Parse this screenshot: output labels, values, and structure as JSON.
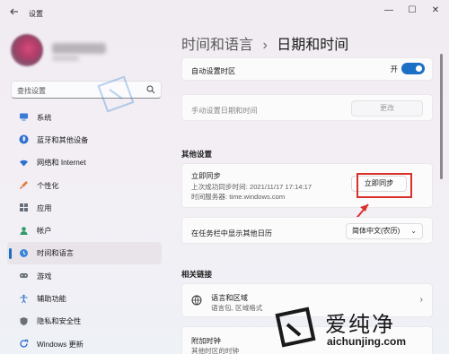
{
  "window": {
    "app_title": "设置",
    "controls": [
      "—",
      "☐",
      "✕"
    ]
  },
  "sidebar": {
    "search_placeholder": "查找设置",
    "items": [
      {
        "label": "系统",
        "icon": "monitor-icon"
      },
      {
        "label": "蓝牙和其他设备",
        "icon": "bluetooth-icon"
      },
      {
        "label": "网络和 Internet",
        "icon": "wifi-icon"
      },
      {
        "label": "个性化",
        "icon": "brush-icon"
      },
      {
        "label": "应用",
        "icon": "apps-icon"
      },
      {
        "label": "帐户",
        "icon": "person-icon"
      },
      {
        "label": "时间和语言",
        "icon": "globe-clock-icon",
        "active": true
      },
      {
        "label": "游戏",
        "icon": "gamepad-icon"
      },
      {
        "label": "辅助功能",
        "icon": "accessibility-icon"
      },
      {
        "label": "隐私和安全性",
        "icon": "shield-icon"
      },
      {
        "label": "Windows 更新",
        "icon": "update-icon"
      }
    ]
  },
  "header": {
    "crumb": "时间和语言",
    "separator": "›",
    "title": "日期和时间"
  },
  "auto_timezone": {
    "label": "自动设置时区",
    "state_text": "开"
  },
  "manual_time": {
    "label": "手动设置日期和时间",
    "button": "更改"
  },
  "other_settings": {
    "title": "其他设置",
    "sync": {
      "label": "立即同步",
      "last_sync": "上次成功同步时间: 2021/11/17 17:14:17",
      "server": "时间服务器: time.windows.com",
      "button": "立即同步"
    },
    "calendar": {
      "label": "在任务栏中显示其他日历",
      "selected": "简体中文(农历)"
    }
  },
  "related": {
    "title": "相关链接",
    "items": [
      {
        "label": "语言和区域",
        "sub": "语言包, 区域格式"
      },
      {
        "label": "附加时钟",
        "sub": "其他时区的时钟"
      }
    ]
  },
  "watermark": {
    "brand": "爱纯净",
    "url": "aichunjing.com"
  },
  "colors": {
    "accent": "#1b6fc4",
    "highlight": "#d9302a"
  }
}
